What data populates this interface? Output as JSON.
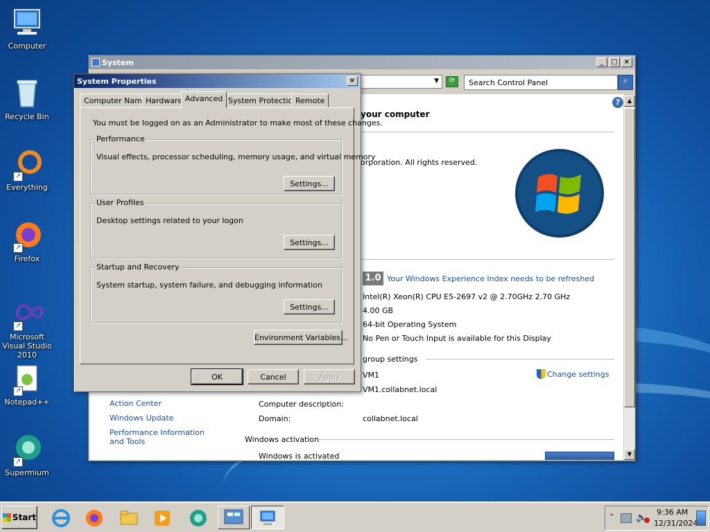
{
  "desktop": {
    "icons": [
      {
        "label": "Computer"
      },
      {
        "label": "Recycle Bin"
      },
      {
        "label": "Everything"
      },
      {
        "label": "Firefox"
      },
      {
        "label": "Microsoft Visual Studio 2010"
      },
      {
        "label": "Notepad++"
      },
      {
        "label": "Supermium"
      }
    ]
  },
  "system_window": {
    "title": "System",
    "search_placeholder": "Search Control Panel",
    "heading": "your computer",
    "copyright": "orporation.  All rights reserved.",
    "rating": {
      "score": "1.0",
      "link": "Your Windows Experience Index needs to be refreshed"
    },
    "processor": "Intel(R) Xeon(R) CPU E5-2697 v2 @ 2.70GHz   2.70 GHz",
    "memory": "4.00 GB",
    "system_type": "64-bit Operating System",
    "pen_touch": "No Pen or Touch Input is available for this Display",
    "group_settings": "group settings",
    "computer_name": "VM1",
    "full_name": "VM1.collabnet.local",
    "change_settings": "Change settings",
    "computer_description_label": "Computer description:",
    "domain_label": "Domain:",
    "domain_value": "collabnet.local",
    "windows_activation": "Windows activation",
    "activated": "Windows is activated",
    "see_also": [
      "Action Center",
      "Windows Update",
      "Performance Information and Tools"
    ]
  },
  "dialog": {
    "title": "System Properties",
    "tabs": [
      "Computer Name",
      "Hardware",
      "Advanced",
      "System Protection",
      "Remote"
    ],
    "admin_note": "You must be logged on as an Administrator to make most of these changes.",
    "performance": {
      "title": "Performance",
      "desc": "Visual effects, processor scheduling, memory usage, and virtual memory",
      "button": "Settings..."
    },
    "user_profiles": {
      "title": "User Profiles",
      "desc": "Desktop settings related to your logon",
      "button": "Settings..."
    },
    "startup": {
      "title": "Startup and Recovery",
      "desc": "System startup, system failure, and debugging information",
      "button": "Settings..."
    },
    "env_button": "Environment Variables...",
    "ok": "OK",
    "cancel": "Cancel",
    "apply": "Apply"
  },
  "taskbar": {
    "start": "Start",
    "time": "9:36 AM",
    "date": "12/31/2024"
  }
}
